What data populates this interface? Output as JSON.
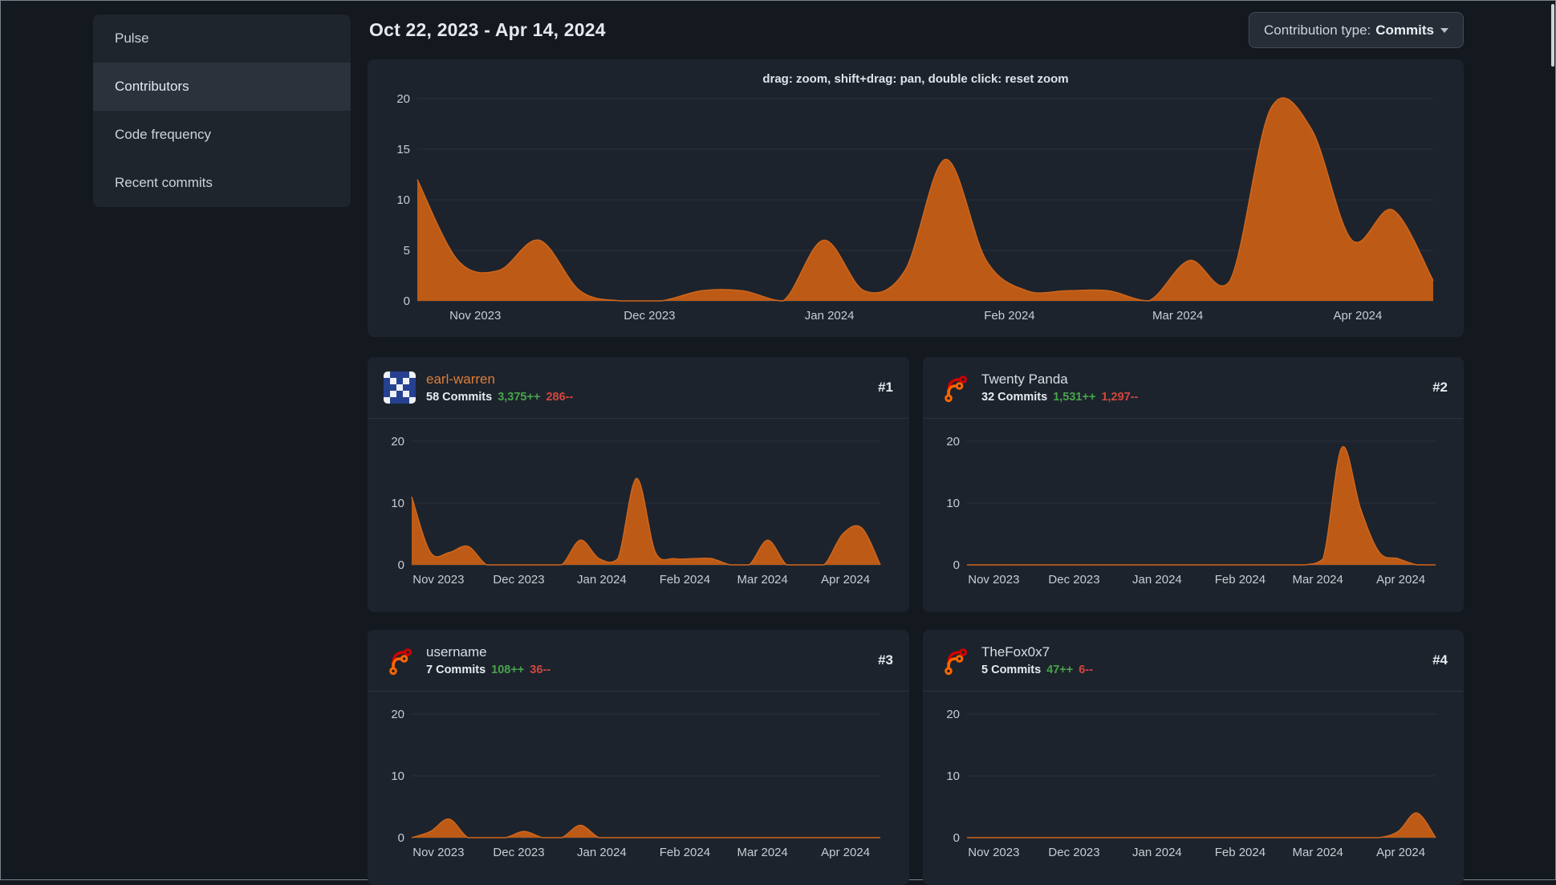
{
  "colors": {
    "page_bg": "#14181f",
    "card_bg": "#1d232c",
    "menu_bg": "#1f252d",
    "menu_active_bg": "#2b323c",
    "heading": "#e3e9ef",
    "link_orange": "#dd7e3b",
    "green": "#47a44c",
    "red": "#d1473f",
    "chart_fill": "#bc5a16",
    "chart_line": "#d0661c",
    "grid_line": "#2c323c",
    "axis_line": "#3f4751",
    "axis_text": "#c6cdd5",
    "button_bg": "#262d36"
  },
  "sidebar": {
    "active_index": 1,
    "items": [
      {
        "label": "Pulse"
      },
      {
        "label": "Contributors"
      },
      {
        "label": "Code frequency"
      },
      {
        "label": "Recent commits"
      }
    ]
  },
  "header": {
    "date_range": "Oct 22, 2023 - Apr 14, 2024"
  },
  "toolbar": {
    "contribution_type_label": "Contribution type:",
    "contribution_type_value": "Commits"
  },
  "chart_data": {
    "type": "area",
    "unit": "commits per week",
    "hint": "drag: zoom, shift+drag: pan, double click: reset zoom",
    "x_range": {
      "start": "Oct 22, 2023",
      "end": "Apr 14, 2024",
      "interval": "week",
      "points": 26
    },
    "month_ticks": [
      {
        "label": "Nov 2023",
        "frac": 0.0571
      },
      {
        "label": "Dec 2023",
        "frac": 0.2286
      },
      {
        "label": "Jan 2024",
        "frac": 0.4057
      },
      {
        "label": "Feb 2024",
        "frac": 0.5829
      },
      {
        "label": "Mar 2024",
        "frac": 0.7486
      },
      {
        "label": "Apr 2024",
        "frac": 0.9257
      }
    ],
    "charts": [
      {
        "name": "all-contributors",
        "ylim": [
          0,
          20
        ],
        "yticks": [
          0,
          5,
          10,
          15,
          20
        ],
        "values": [
          12,
          4,
          3,
          6,
          1,
          0,
          0,
          1,
          1,
          0,
          6,
          1,
          3,
          14,
          4,
          1,
          1,
          1,
          0,
          4,
          2,
          19,
          17,
          6,
          9,
          2
        ]
      },
      {
        "name": "earl-warren",
        "ylim": [
          0,
          20
        ],
        "yticks": [
          0,
          10,
          20
        ],
        "values": [
          11,
          2,
          2,
          3,
          0,
          0,
          0,
          0,
          0,
          4,
          1,
          1,
          14,
          2,
          1,
          1,
          1,
          0,
          0,
          4,
          0,
          0,
          0,
          5,
          6,
          0
        ]
      },
      {
        "name": "Twenty Panda",
        "ylim": [
          0,
          20
        ],
        "yticks": [
          0,
          10,
          20
        ],
        "values": [
          0,
          0,
          0,
          0,
          0,
          0,
          0,
          0,
          0,
          0,
          0,
          0,
          0,
          0,
          0,
          0,
          0,
          0,
          0,
          1,
          19,
          9,
          2,
          1,
          0,
          0
        ]
      },
      {
        "name": "username",
        "ylim": [
          0,
          20
        ],
        "yticks": [
          0,
          10,
          20
        ],
        "values": [
          0,
          1,
          3,
          0,
          0,
          0,
          1,
          0,
          0,
          2,
          0,
          0,
          0,
          0,
          0,
          0,
          0,
          0,
          0,
          0,
          0,
          0,
          0,
          0,
          0,
          0
        ]
      },
      {
        "name": "TheFox0x7",
        "ylim": [
          0,
          20
        ],
        "yticks": [
          0,
          10,
          20
        ],
        "values": [
          0,
          0,
          0,
          0,
          0,
          0,
          0,
          0,
          0,
          0,
          0,
          0,
          0,
          0,
          0,
          0,
          0,
          0,
          0,
          0,
          0,
          0,
          0,
          1,
          4,
          0
        ]
      }
    ]
  },
  "contributors": [
    {
      "name": "earl-warren",
      "rank": "#1",
      "commits": "58 Commits",
      "additions": "3,375++",
      "deletions": "286--",
      "avatar": "identicon",
      "name_color": "#dd7e3b"
    },
    {
      "name": "Twenty Panda",
      "rank": "#2",
      "commits": "32 Commits",
      "additions": "1,531++",
      "deletions": "1,297--",
      "avatar": "forgejo-logo",
      "name_color": "#d7dee6"
    },
    {
      "name": "username",
      "rank": "#3",
      "commits": "7 Commits",
      "additions": "108++",
      "deletions": "36--",
      "avatar": "forgejo-logo",
      "name_color": "#d7dee6"
    },
    {
      "name": "TheFox0x7",
      "rank": "#4",
      "commits": "5 Commits",
      "additions": "47++",
      "deletions": "6--",
      "avatar": "forgejo-logo",
      "name_color": "#d7dee6"
    }
  ]
}
